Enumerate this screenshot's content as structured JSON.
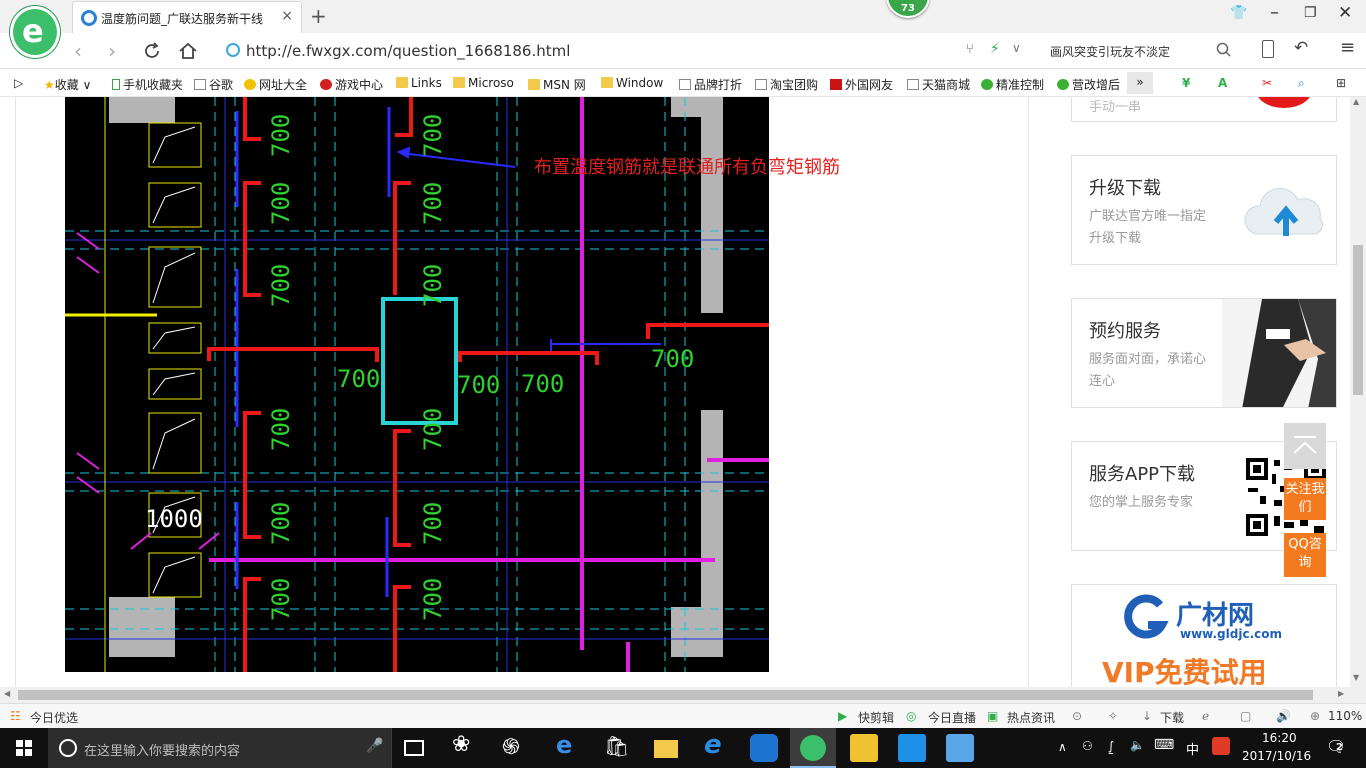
{
  "browser": {
    "tab_title": "温度筋问题_广联达服务新干线",
    "tab_close": "×",
    "new_tab": "+",
    "badge_count": "73",
    "url": "http://e.fwxgx.com/question_1668186.html",
    "search_text": "画风突变引玩友不淡定"
  },
  "bookmarks": [
    {
      "label": "收藏",
      "type": "star"
    },
    {
      "label": "手机收藏夹",
      "type": "phone"
    },
    {
      "label": "谷歌",
      "type": "page"
    },
    {
      "label": "网址大全",
      "type": "globe"
    },
    {
      "label": "游戏中心",
      "type": "game"
    },
    {
      "label": "Links",
      "type": "folder"
    },
    {
      "label": "Microso",
      "type": "folder"
    },
    {
      "label": "MSN 网",
      "type": "folder"
    },
    {
      "label": "Window",
      "type": "folder"
    },
    {
      "label": "品牌打折",
      "type": "page"
    },
    {
      "label": "淘宝团购",
      "type": "page"
    },
    {
      "label": "外国网友",
      "type": "page"
    },
    {
      "label": "天猫商城",
      "type": "page"
    },
    {
      "label": "精准控制",
      "type": "wechat"
    },
    {
      "label": "营改增后",
      "type": "wechat"
    }
  ],
  "main": {
    "annotation": "布置温度钢筋就是联通所有负弯矩钢筋",
    "dimension_labels": [
      "700",
      "700",
      "700",
      "700",
      "1000"
    ],
    "sidebar_cards": [
      {
        "title": "手动一串",
        "desc": ""
      },
      {
        "title": "升级下载",
        "desc": "广联达官方唯一指定升级下载"
      },
      {
        "title": "预约服务",
        "desc": "服务面对面，承诺心连心"
      },
      {
        "title": "服务APP下载",
        "desc": "您的掌上服务专家"
      }
    ],
    "ad": {
      "brand": "广材网",
      "domain": "www.gldjc.com",
      "slogan": "VIP免费试用"
    },
    "float_follow": "关注我们",
    "float_qq": "QQ咨询"
  },
  "statusbar": {
    "left": "今日优选",
    "items": [
      "快剪辑",
      "今日直播",
      "热点资讯",
      "下载"
    ],
    "zoom": "110%"
  },
  "taskbar": {
    "search_placeholder": "在这里输入你要搜索的内容",
    "ime": "中",
    "time": "16:20",
    "date": "2017/10/16",
    "notifications": "2"
  }
}
